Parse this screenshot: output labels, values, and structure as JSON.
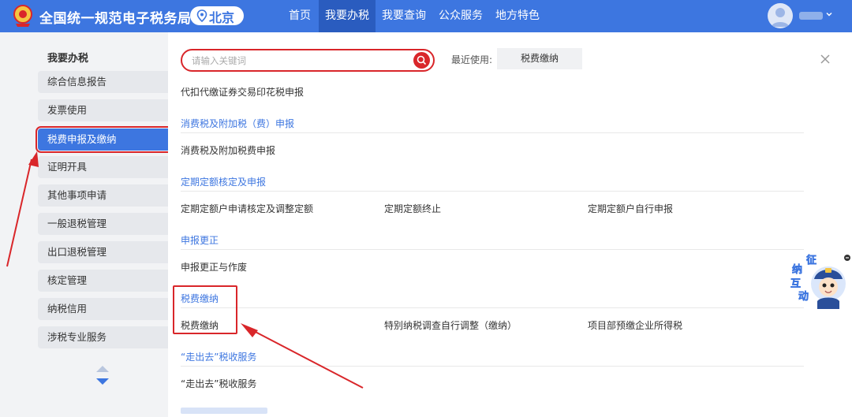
{
  "header": {
    "title": "全国统一规范电子税务局",
    "location": "北京",
    "nav": [
      {
        "label": "首页",
        "active": false
      },
      {
        "label": "我要办税",
        "active": true
      },
      {
        "label": "我要查询",
        "active": false
      },
      {
        "label": "公众服务",
        "active": false
      },
      {
        "label": "地方特色",
        "active": false
      }
    ]
  },
  "sidebar": {
    "title": "我要办税",
    "items": [
      {
        "label": "综合信息报告"
      },
      {
        "label": "发票使用"
      },
      {
        "label": "税费申报及缴纳"
      },
      {
        "label": "证明开具"
      },
      {
        "label": "其他事项申请"
      },
      {
        "label": "一般退税管理"
      },
      {
        "label": "出口退税管理"
      },
      {
        "label": "核定管理"
      },
      {
        "label": "纳税信用"
      },
      {
        "label": "涉税专业服务"
      }
    ],
    "active_index": 2
  },
  "main": {
    "search_placeholder": "请输入关键词",
    "recent_label": "最近使用:",
    "recent_item": "税费缴纳",
    "top_item": "代扣代缴证券交易印花税申报",
    "sections": [
      {
        "title": "消费税及附加税（费）申报",
        "items": [
          "消费税及附加税费申报"
        ]
      },
      {
        "title": "定期定额核定及申报",
        "items": [
          "定期定额户申请核定及调整定额",
          "定期定额终止",
          "定期定额户自行申报"
        ]
      },
      {
        "title": "申报更正",
        "items": [
          "申报更正与作废"
        ]
      },
      {
        "title": "税费缴纳",
        "items": [
          "税费缴纳",
          "特别纳税调查自行调整（缴纳）",
          "项目部预缴企业所得税"
        ]
      },
      {
        "title": "“走出去”税收服务",
        "items": [
          "“走出去”税收服务"
        ]
      }
    ]
  },
  "mascot": {
    "chars": [
      "征",
      "纳",
      "互",
      "动"
    ]
  },
  "colors": {
    "primary": "#3d76e0",
    "highlight": "#d9262a"
  }
}
